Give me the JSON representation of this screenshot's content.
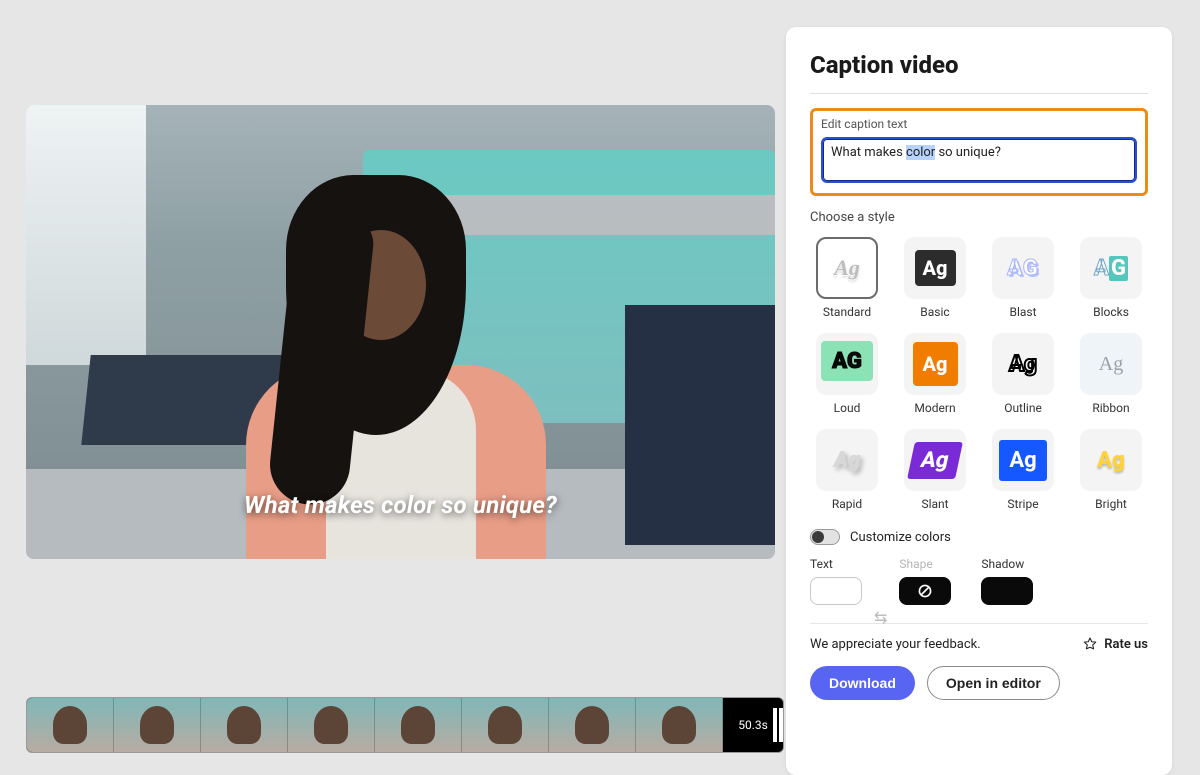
{
  "panel": {
    "title": "Caption video",
    "edit_label": "Edit caption text",
    "caption_pre": "What makes ",
    "caption_highlight": "color",
    "caption_post": " so unique?",
    "choose_label": "Choose a style",
    "customize_label": "Customize colors",
    "color_labels": {
      "text": "Text",
      "shape": "Shape",
      "shadow": "Shadow"
    },
    "feedback": "We appreciate your feedback.",
    "rate": "Rate us",
    "download": "Download",
    "open": "Open in editor"
  },
  "video": {
    "caption_overlay": "What makes color so unique?",
    "duration": "50.3s"
  },
  "styles": [
    {
      "id": "standard",
      "name": "Standard",
      "selected": true
    },
    {
      "id": "basic",
      "name": "Basic"
    },
    {
      "id": "blast",
      "name": "Blast"
    },
    {
      "id": "blocks",
      "name": "Blocks"
    },
    {
      "id": "loud",
      "name": "Loud"
    },
    {
      "id": "modern",
      "name": "Modern"
    },
    {
      "id": "outline",
      "name": "Outline"
    },
    {
      "id": "ribbon",
      "name": "Ribbon"
    },
    {
      "id": "rapid",
      "name": "Rapid"
    },
    {
      "id": "slant",
      "name": "Slant"
    },
    {
      "id": "stripe",
      "name": "Stripe"
    },
    {
      "id": "bright",
      "name": "Bright"
    }
  ],
  "colors": {
    "text": "#ffffff",
    "shape": null,
    "shadow": "#000000"
  }
}
